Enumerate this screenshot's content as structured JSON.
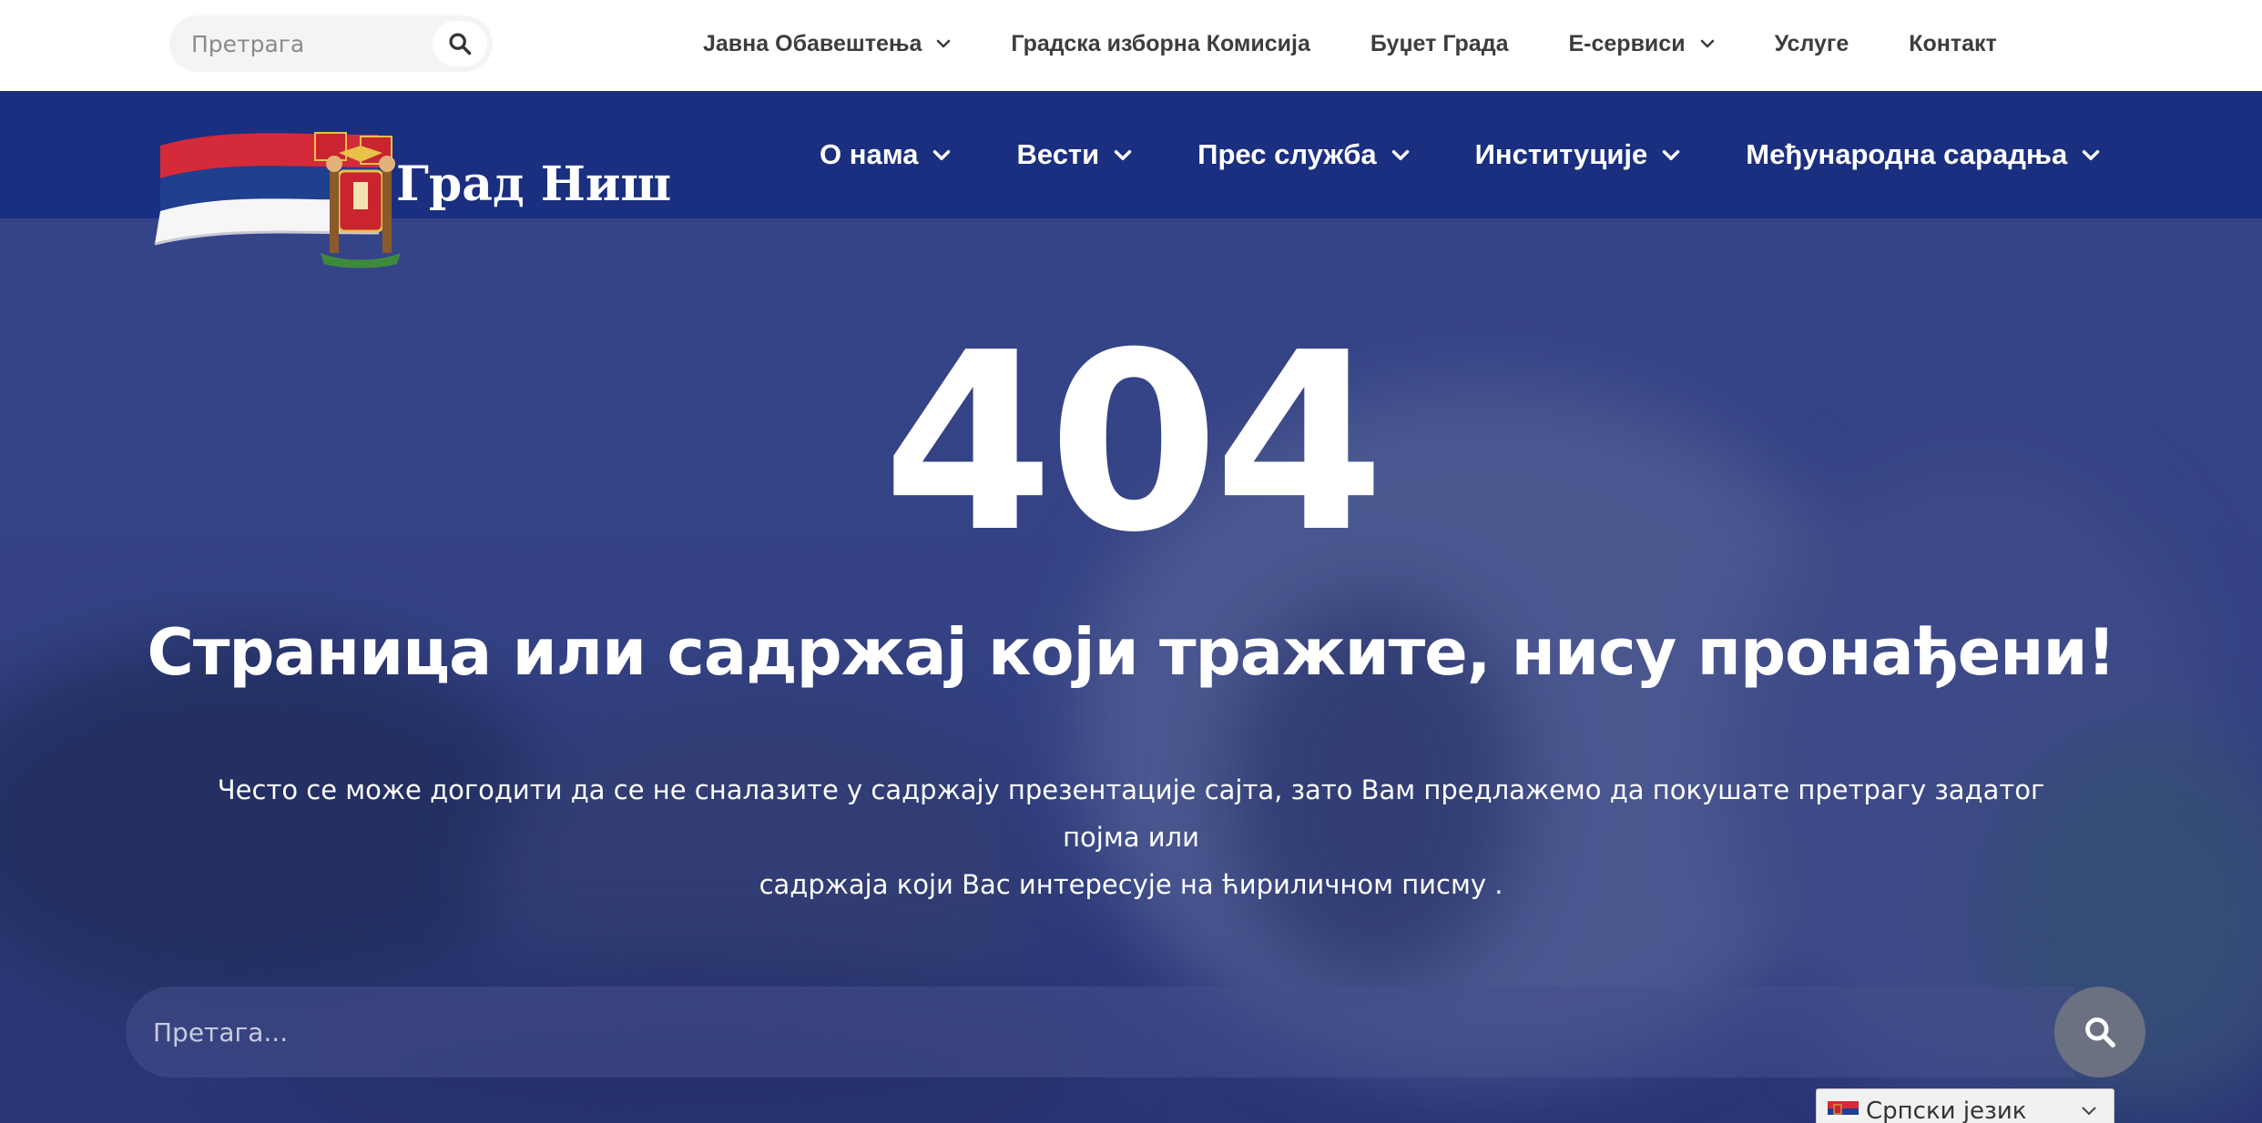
{
  "top_search": {
    "placeholder": "Претрага"
  },
  "top_nav": [
    {
      "label": "Јавна Обавештења",
      "has_dropdown": true
    },
    {
      "label": "Градска изборна Комисија",
      "has_dropdown": false
    },
    {
      "label": "Буџет Града",
      "has_dropdown": false
    },
    {
      "label": "Е-сервиси",
      "has_dropdown": true
    },
    {
      "label": "Услуге",
      "has_dropdown": false
    },
    {
      "label": "Контакт",
      "has_dropdown": false
    }
  ],
  "logo": {
    "text": "Град Ниш"
  },
  "main_nav": [
    {
      "label": "О нама",
      "has_dropdown": true
    },
    {
      "label": "Вести",
      "has_dropdown": true
    },
    {
      "label": "Прес служба",
      "has_dropdown": true
    },
    {
      "label": "Институције",
      "has_dropdown": true
    },
    {
      "label": "Међународна сарадња",
      "has_dropdown": true
    }
  ],
  "hero": {
    "code": "404",
    "headline": "Страница или садржај који тражите, нису пронађени!",
    "description_line1": "Често  се може догодити да се не сналазите у садржају презентације сајта, зато Вам предлажемо да покушате претрагу задатог појма или",
    "description_line2": "садржаја који Вас интересује на ћириличном писму ."
  },
  "hero_search": {
    "placeholder": "Претага..."
  },
  "language": {
    "selected": "Српски језик"
  },
  "colors": {
    "topbar_bg": "#ffffff",
    "header_bg": "#1a2f7f",
    "hero_tint": "#3d4d8c",
    "search_button": "#6b7180",
    "flag_red": "#d42a3a",
    "flag_blue": "#1f3f8f"
  },
  "icons": {
    "top_search": "search-icon",
    "hero_search": "search-icon",
    "dropdown": "chevron-down-icon"
  }
}
